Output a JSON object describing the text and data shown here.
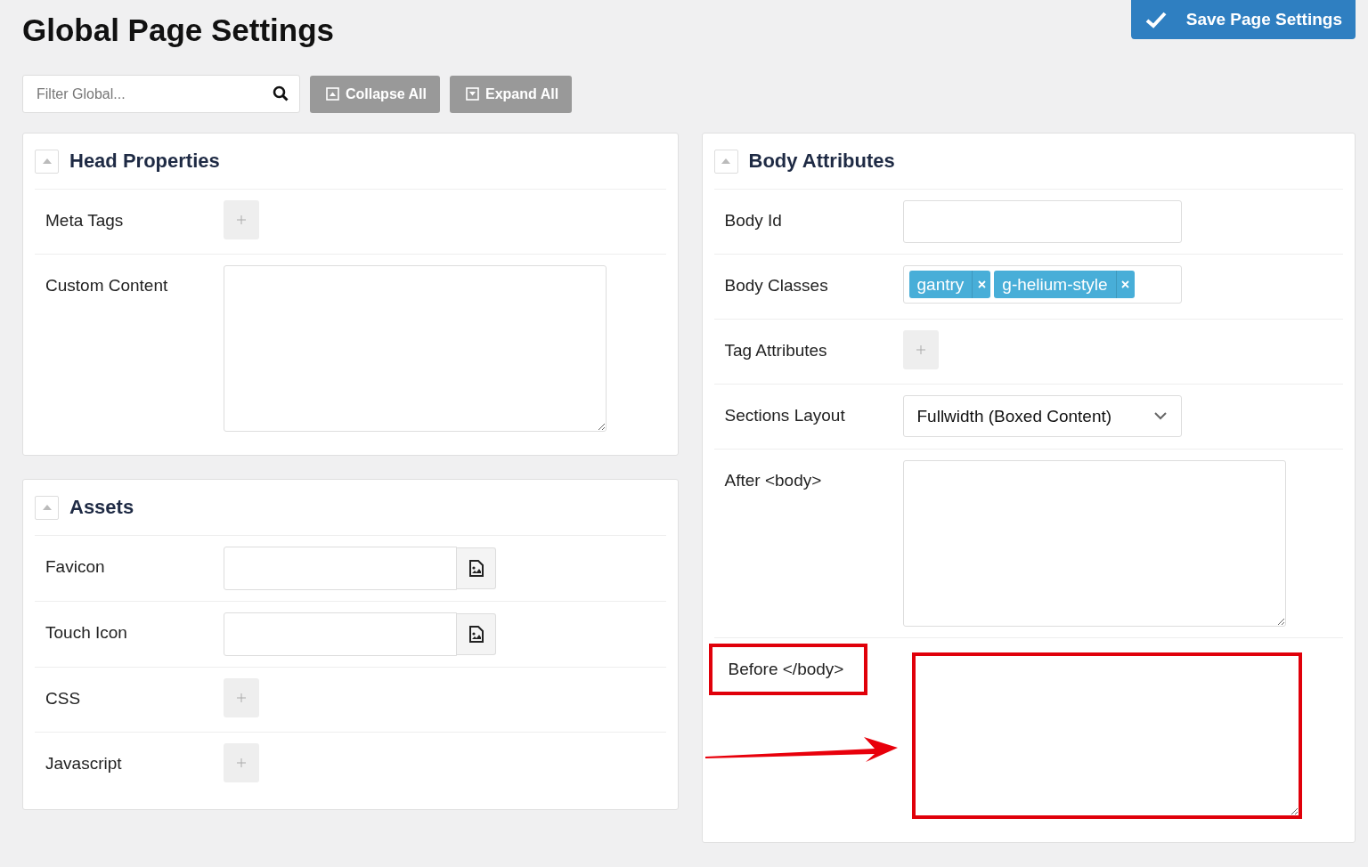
{
  "title": "Global Page Settings",
  "save_button": "Save Page Settings",
  "toolbar": {
    "filter": {
      "placeholder": "Filter Global..."
    },
    "buttons": [
      {
        "kind": "collapse",
        "label": "Collapse All"
      },
      {
        "kind": "expand",
        "label": "Expand All"
      }
    ]
  },
  "columns": [
    [
      {
        "title": "Head Properties",
        "expanded": true,
        "rows": [
          {
            "label": "Meta Tags",
            "kind": "add",
            "highlighted": false
          },
          {
            "label": "Custom Content",
            "kind": "textarea",
            "highlighted": false
          }
        ]
      },
      {
        "title": "Assets",
        "expanded": true,
        "rows": [
          {
            "label": "Favicon",
            "kind": "file",
            "highlighted": false
          },
          {
            "label": "Touch Icon",
            "kind": "file",
            "highlighted": false
          },
          {
            "label": "CSS",
            "kind": "add",
            "highlighted": false
          },
          {
            "label": "Javascript",
            "kind": "add",
            "highlighted": false
          }
        ]
      }
    ],
    [
      {
        "title": "Body Attributes",
        "expanded": true,
        "rows": [
          {
            "label": "Body Id",
            "kind": "text",
            "highlighted": false
          },
          {
            "label": "Body Classes",
            "kind": "tags",
            "highlighted": false,
            "tags": [
              "gantry",
              "g-helium-style"
            ]
          },
          {
            "label": "Tag Attributes",
            "kind": "add",
            "highlighted": false
          },
          {
            "label": "Sections Layout",
            "kind": "select",
            "highlighted": false,
            "value": "Fullwidth (Boxed Content)"
          },
          {
            "label": "After <body>",
            "kind": "textarea",
            "highlighted": false
          },
          {
            "label": "Before </body>",
            "kind": "textarea",
            "highlighted": true
          }
        ]
      }
    ]
  ]
}
